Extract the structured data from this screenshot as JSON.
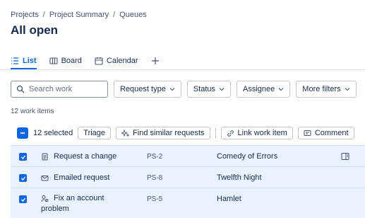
{
  "breadcrumb": [
    "Projects",
    "Project Summary",
    "Queues"
  ],
  "title": "All open",
  "tabs": [
    {
      "label": "List",
      "icon": "list-icon",
      "active": true
    },
    {
      "label": "Board",
      "icon": "board-icon"
    },
    {
      "label": "Calendar",
      "icon": "calendar-icon"
    }
  ],
  "search": {
    "placeholder": "Search work"
  },
  "filters": [
    "Request type",
    "Status",
    "Assignee",
    "More filters"
  ],
  "count_text": "12 work items",
  "bulk": {
    "selected_text": "12 selected",
    "triage": "Triage",
    "similar": "Find similar requests",
    "link": "Link work item",
    "comment": "Comment"
  },
  "rows": [
    {
      "summary": "Request a change",
      "key": "PS-2",
      "source": "Comedy of Errors",
      "icon": "form-icon"
    },
    {
      "summary": "Emailed request",
      "key": "PS-8",
      "source": "Twelfth Night",
      "icon": "email-icon"
    },
    {
      "summary_line1": "Fix an account",
      "summary_line2": "problem",
      "key": "PS-5",
      "source": "Hamlet",
      "icon": "account-icon"
    }
  ],
  "colors": {
    "accent": "#0c66e4",
    "selected_row": "#e9f2ff"
  }
}
